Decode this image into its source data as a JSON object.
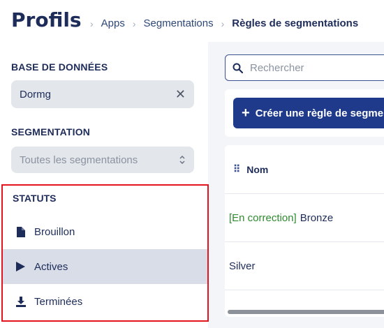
{
  "header": {
    "title": "Profils",
    "breadcrumbs": [
      "Apps",
      "Segmentations",
      "Règles de segmentations"
    ]
  },
  "sidebar": {
    "database": {
      "label": "BASE DE DONNÉES",
      "value": "Dormg"
    },
    "segmentation": {
      "label": "SEGMENTATION",
      "selected": "Toutes les segmentations"
    },
    "statuses": {
      "label": "STATUTS",
      "items": [
        {
          "label": "Brouillon",
          "icon": "file-icon",
          "active": false
        },
        {
          "label": "Actives",
          "icon": "play-icon",
          "active": true
        },
        {
          "label": "Terminées",
          "icon": "download-icon",
          "active": false
        }
      ]
    }
  },
  "main": {
    "search": {
      "placeholder": "Rechercher"
    },
    "create_label": "Créer une règle de segmentation",
    "table": {
      "column": "Nom",
      "rows": [
        {
          "tag": "[En correction]",
          "name": "Bronze"
        },
        {
          "tag": "",
          "name": "Silver"
        }
      ]
    }
  },
  "colors": {
    "primary": "#1f3a8a",
    "highlight_border": "#e4141e",
    "tag_green": "#2e8b2e",
    "active_row": "#d8dde7"
  }
}
